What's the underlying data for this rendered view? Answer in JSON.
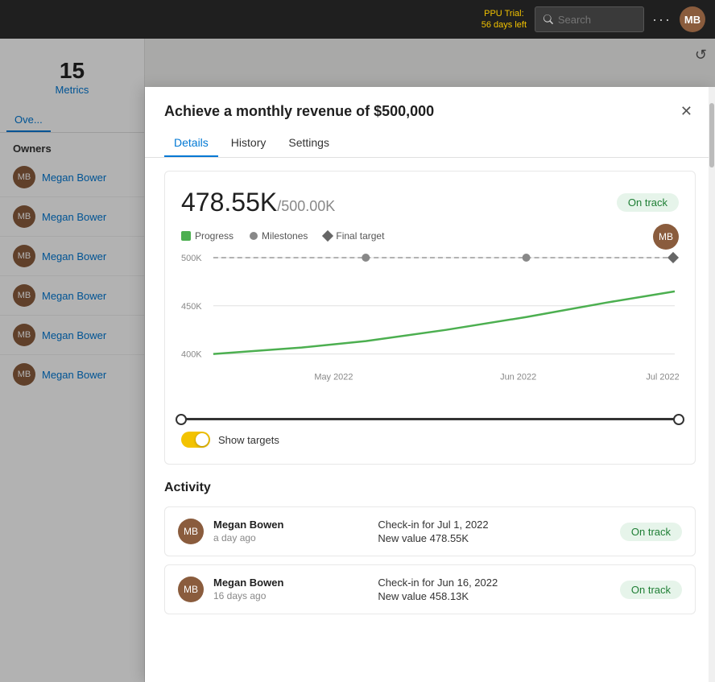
{
  "topbar": {
    "ppu_trial_label": "PPU Trial:",
    "ppu_trial_days": "56 days left",
    "search_placeholder": "Search",
    "search_label": "Search"
  },
  "left_panel": {
    "metrics_count": "15",
    "metrics_label": "Metrics",
    "nav_tabs": [
      {
        "id": "overview",
        "label": "Ove..."
      }
    ],
    "owners_header": "Owners",
    "owners": [
      {
        "name": "Megan Bower",
        "initials": "MB"
      },
      {
        "name": "Megan Bower",
        "initials": "MB"
      },
      {
        "name": "Megan Bower",
        "initials": "MB"
      },
      {
        "name": "Megan Bower",
        "initials": "MB"
      },
      {
        "name": "Megan Bower",
        "initials": "MB"
      },
      {
        "name": "Megan Bower",
        "initials": "MB"
      }
    ]
  },
  "modal": {
    "title": "Achieve a monthly revenue of $500,000",
    "tabs": [
      {
        "id": "details",
        "label": "Details"
      },
      {
        "id": "history",
        "label": "History"
      },
      {
        "id": "settings",
        "label": "Settings"
      }
    ],
    "chart_section": {
      "current_value": "478.55K",
      "target_value": "/500.00K",
      "on_track_label": "On track",
      "legend": [
        {
          "type": "progress",
          "label": "Progress"
        },
        {
          "type": "milestones",
          "label": "Milestones"
        },
        {
          "type": "final_target",
          "label": "Final target"
        }
      ],
      "chart_y_labels": [
        "500K",
        "450K",
        "400K"
      ],
      "chart_x_labels": [
        "May 2022",
        "Jun 2022",
        "Jul 2022"
      ],
      "show_targets_label": "Show targets"
    },
    "activity_section": {
      "title": "Activity",
      "items": [
        {
          "name": "Megan Bowen",
          "initials": "MB",
          "time": "a day ago",
          "check_in": "Check-in for Jul 1, 2022",
          "new_value": "New value 478.55K",
          "badge": "On track"
        },
        {
          "name": "Megan Bowen",
          "initials": "MB",
          "time": "16 days ago",
          "check_in": "Check-in for Jun 16, 2022",
          "new_value": "New value 458.13K",
          "badge": "On track"
        }
      ]
    }
  }
}
